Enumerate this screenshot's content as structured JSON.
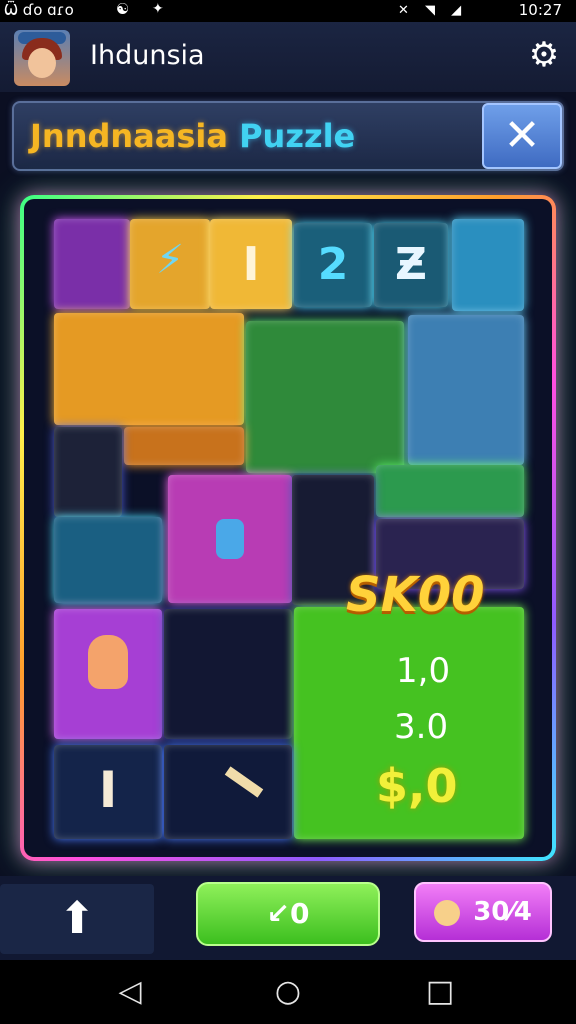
{
  "status_bar": {
    "left_text": "Ѿ ɗo ɑɾo",
    "icon_a": "☯",
    "icon_b": "✦",
    "signal_icons": "✕ ◥ ◢",
    "time": "10:27"
  },
  "app_bar": {
    "title": "Ihdunsia",
    "avatar_icon": "avatar",
    "settings_icon": "gear-icon"
  },
  "title_bar": {
    "title_part1": "Jnndnaasia",
    "title_part2": "Puzzle",
    "close_label": "✕"
  },
  "board": {
    "top_symbols": [
      "⚡",
      "I",
      "2",
      "Ƶ"
    ],
    "bottom_symbol": "I",
    "score_label": "SK00",
    "stat_1": "1,0",
    "stat_2": "3.0",
    "money": "$,0",
    "colors": {
      "border": [
        "#39ff86",
        "#ffef4a",
        "#ff9d2c",
        "#ff4fe0",
        "#8f5bff",
        "#3ee7ff"
      ],
      "green_panel": "#44c020",
      "yellow_tile": "#f2b33a",
      "purple_tile": "#b53ad8",
      "blue_tile": "#1d6fa0"
    }
  },
  "action_bar": {
    "up_label": "⬆",
    "green_button_label": "↙0",
    "pink_button_label": "30⁄4"
  },
  "nav_bar": {
    "back": "◁",
    "home": "○",
    "recent": "□"
  }
}
